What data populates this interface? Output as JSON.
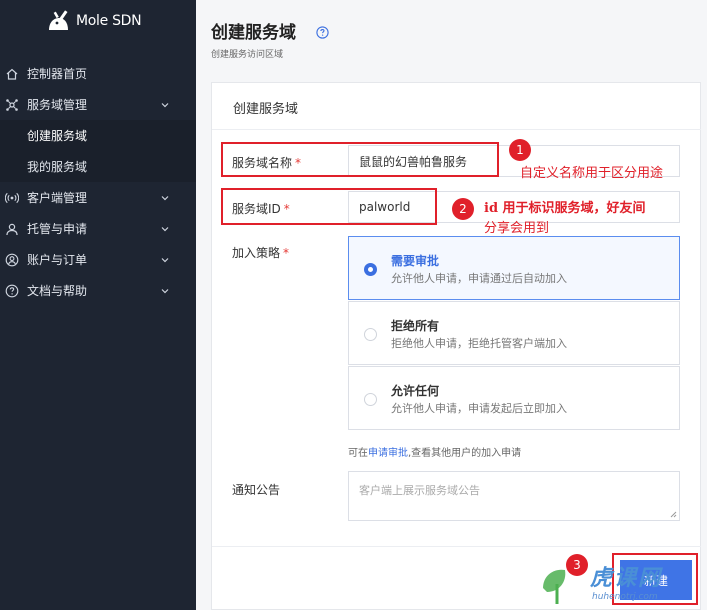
{
  "app": {
    "name": "Mole SDN"
  },
  "sidebar": {
    "items": [
      {
        "label": "控制器首页",
        "icon": "home-icon"
      },
      {
        "label": "服务域管理",
        "icon": "network-icon",
        "expanded": true,
        "children": [
          {
            "label": "创建服务域",
            "active": true
          },
          {
            "label": "我的服务域"
          }
        ]
      },
      {
        "label": "客户端管理",
        "icon": "broadcast-icon"
      },
      {
        "label": "托管与申请",
        "icon": "user-group-icon"
      },
      {
        "label": "账户与订单",
        "icon": "account-icon"
      },
      {
        "label": "文档与帮助",
        "icon": "help-circle-icon"
      }
    ]
  },
  "header": {
    "title": "创建服务域",
    "subtitle": "创建服务访问区域"
  },
  "form": {
    "card_title": "创建服务域",
    "name_label": "服务域名称",
    "name_value": "鼠鼠的幻兽帕鲁服务",
    "id_label": "服务域ID",
    "id_value": "palworld",
    "required_mark": "*",
    "policy_label": "加入策略",
    "policy_options": [
      {
        "title": "需要审批",
        "desc": "允许他人申请，申请通过后自动加入",
        "selected": true
      },
      {
        "title": "拒绝所有",
        "desc": "拒绝他人申请，拒绝托管客户端加入",
        "selected": false
      },
      {
        "title": "允许任何",
        "desc": "允许他人申请，申请发起后立即加入",
        "selected": false
      }
    ],
    "hint_prefix": "可在",
    "hint_link": "申请审批",
    "hint_suffix": ",查看其他用户的加入申请",
    "notice_label": "通知公告",
    "notice_placeholder": "客户端上展示服务域公告",
    "submit_label": "新建"
  },
  "annotations": {
    "n1": "1",
    "n2": "2",
    "n3": "3",
    "text1": "自定义名称用于区分用途",
    "text2_line1": "id 用于标识服务域，好友间",
    "text2_line2": "分享会用到"
  },
  "watermark": {
    "text": "虎课网",
    "url": "huhenotrj.com"
  },
  "colors": {
    "sidebar_bg": "#1e2532",
    "accent": "#3b6fe0",
    "annotation": "#e0202a"
  }
}
